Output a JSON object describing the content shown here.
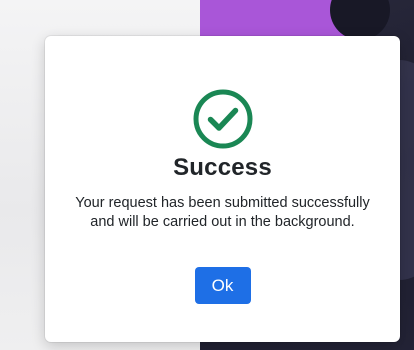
{
  "modal": {
    "title": "Success",
    "message": "Your request has been submitted successfully and will be carried out in the background.",
    "ok_label": "Ok",
    "icon": "check-circle-icon"
  },
  "colors": {
    "success_green": "#1a8754",
    "button_blue": "#1e6fe6",
    "background_accent": "#a956d8"
  }
}
